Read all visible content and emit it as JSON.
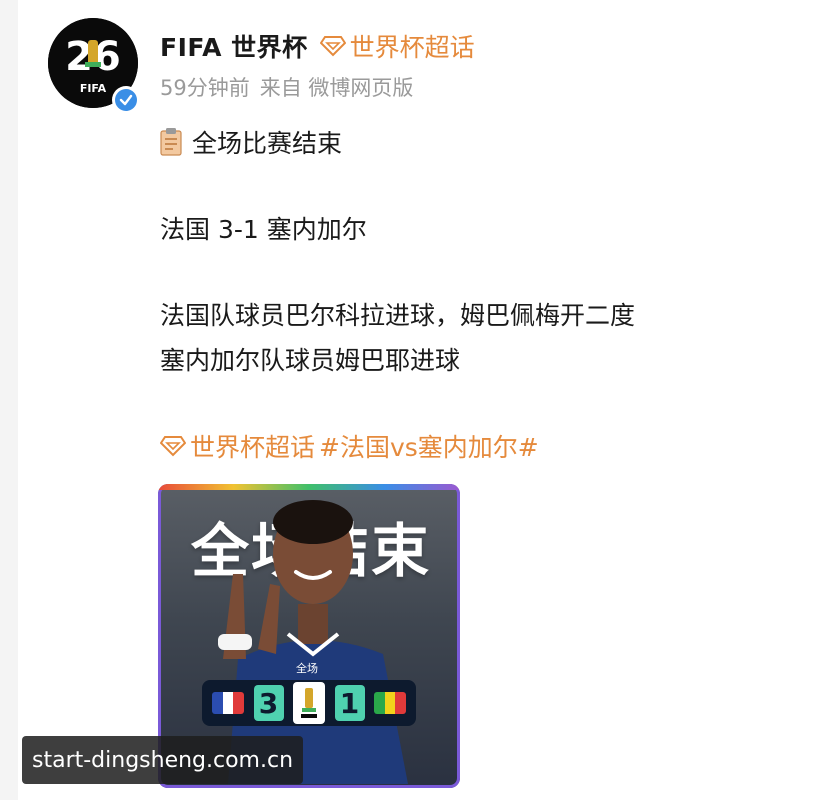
{
  "post": {
    "author_name": "FIFA 世界杯",
    "supertopic_label": "世界杯超话",
    "meta": {
      "time": "59分钟前",
      "source": "来自 微博网页版"
    },
    "avatar_text": "FIFA",
    "lines": [
      "全场比赛结束",
      "法国 3-1 塞内加尔",
      "法国队球员巴尔科拉进球，姆巴佩梅开二度",
      "塞内加尔队球员姆巴耶进球"
    ],
    "topic": {
      "supertopic": "世界杯超话",
      "hashtag": "#法国vs塞内加尔#"
    }
  },
  "media": {
    "title": "全场结束",
    "score_label": "全场",
    "home_score": "3",
    "away_score": "1"
  },
  "watermark": "start-dingsheng.com.cn",
  "colors": {
    "accent_orange": "#e58a3c",
    "verified_blue": "#3a8ee6",
    "score_green": "#4fd1b0"
  }
}
